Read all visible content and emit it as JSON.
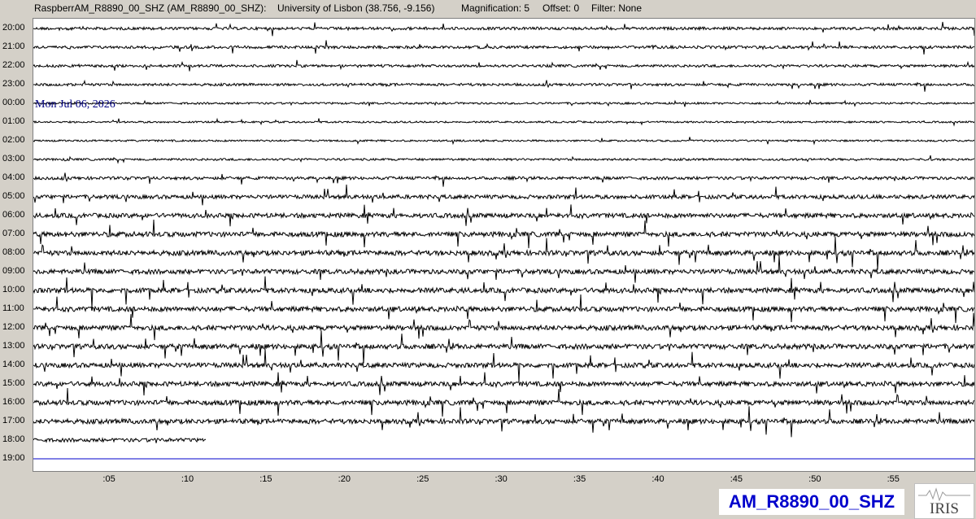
{
  "header": {
    "station": "RaspberrAM_R8890_00_SHZ (AM_R8890_00_SHZ):",
    "location": "University of Lisbon (38.756, -9.156)",
    "magnification": "Magnification: 5",
    "offset": "Offset: 0",
    "filter": "Filter: None"
  },
  "date_label": "Mon Jul 06, 2026",
  "station_badge": "AM_R8890_00_SHZ",
  "logo": {
    "text": "IRIS",
    "icon": "iris-logo-icon"
  },
  "colors": {
    "trace": "#000000",
    "current_line": "#0000cc",
    "date": "#000080",
    "badge": "#0000cc"
  },
  "chart_data": {
    "type": "line",
    "title": "",
    "xlabel": "",
    "ylabel": "",
    "x_unit": "minutes",
    "xlim": [
      0,
      60
    ],
    "x_ticks": [
      ":05",
      ":10",
      ":15",
      ":20",
      ":25",
      ":30",
      ":35",
      ":40",
      ":45",
      ":50",
      ":55"
    ],
    "x_tick_values": [
      5,
      10,
      15,
      20,
      25,
      30,
      35,
      40,
      45,
      50,
      55
    ],
    "rows": [
      {
        "label": "20:00",
        "activity": 0.35,
        "filled_to_minute": 60
      },
      {
        "label": "21:00",
        "activity": 0.35,
        "filled_to_minute": 60
      },
      {
        "label": "22:00",
        "activity": 0.3,
        "filled_to_minute": 60
      },
      {
        "label": "23:00",
        "activity": 0.3,
        "filled_to_minute": 60
      },
      {
        "label": "00:00",
        "activity": 0.15,
        "filled_to_minute": 60
      },
      {
        "label": "01:00",
        "activity": 0.1,
        "filled_to_minute": 60
      },
      {
        "label": "02:00",
        "activity": 0.12,
        "filled_to_minute": 60
      },
      {
        "label": "03:00",
        "activity": 0.2,
        "filled_to_minute": 60
      },
      {
        "label": "04:00",
        "activity": 0.4,
        "filled_to_minute": 60
      },
      {
        "label": "05:00",
        "activity": 0.6,
        "filled_to_minute": 60
      },
      {
        "label": "06:00",
        "activity": 0.75,
        "filled_to_minute": 60
      },
      {
        "label": "07:00",
        "activity": 0.85,
        "filled_to_minute": 60
      },
      {
        "label": "08:00",
        "activity": 0.85,
        "filled_to_minute": 60
      },
      {
        "label": "09:00",
        "activity": 0.8,
        "filled_to_minute": 60
      },
      {
        "label": "10:00",
        "activity": 0.85,
        "filled_to_minute": 60
      },
      {
        "label": "11:00",
        "activity": 0.85,
        "filled_to_minute": 60
      },
      {
        "label": "12:00",
        "activity": 0.85,
        "filled_to_minute": 60
      },
      {
        "label": "13:00",
        "activity": 0.85,
        "filled_to_minute": 60
      },
      {
        "label": "14:00",
        "activity": 0.8,
        "filled_to_minute": 60
      },
      {
        "label": "15:00",
        "activity": 0.8,
        "filled_to_minute": 60
      },
      {
        "label": "16:00",
        "activity": 0.85,
        "filled_to_minute": 60
      },
      {
        "label": "17:00",
        "activity": 0.8,
        "filled_to_minute": 60
      },
      {
        "label": "18:00",
        "activity": 0.55,
        "filled_to_minute": 11
      },
      {
        "label": "19:00",
        "activity": 0.0,
        "filled_to_minute": 0
      }
    ],
    "current_time_row": "19:00",
    "grid": false
  }
}
